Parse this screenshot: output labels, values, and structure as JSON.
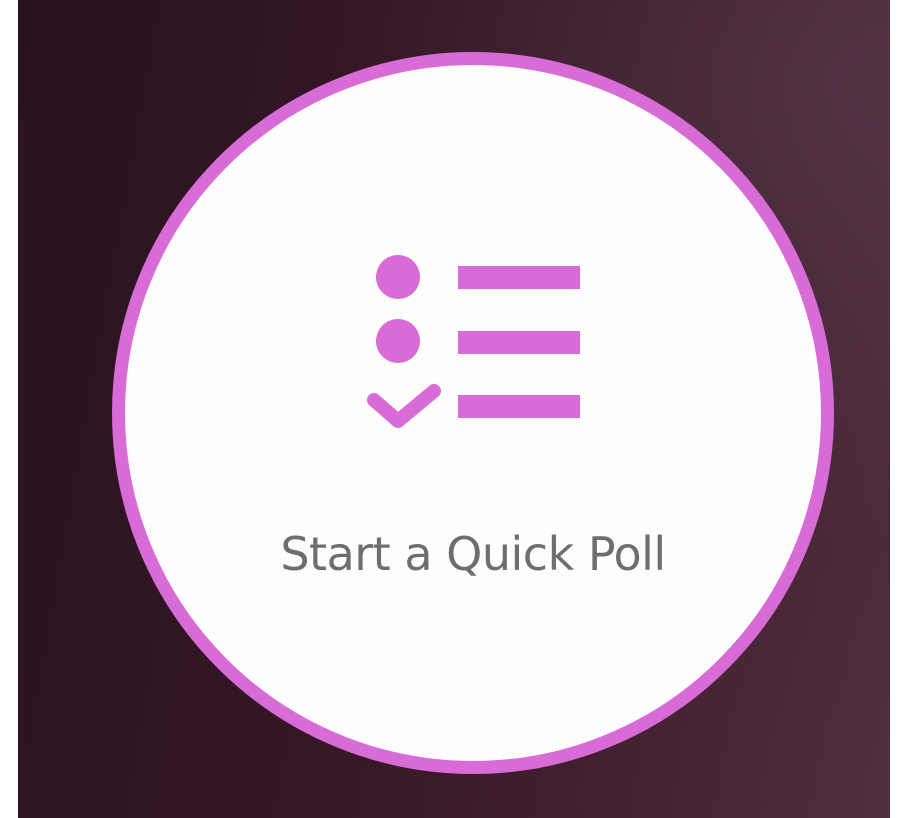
{
  "quick_poll": {
    "label": "Start a Quick Poll",
    "icon": "poll-list-icon"
  },
  "colors": {
    "accent": "#d86bd6",
    "background": "#361826",
    "button_fill": "#fefdfe",
    "label_text": "#6e6e70"
  }
}
